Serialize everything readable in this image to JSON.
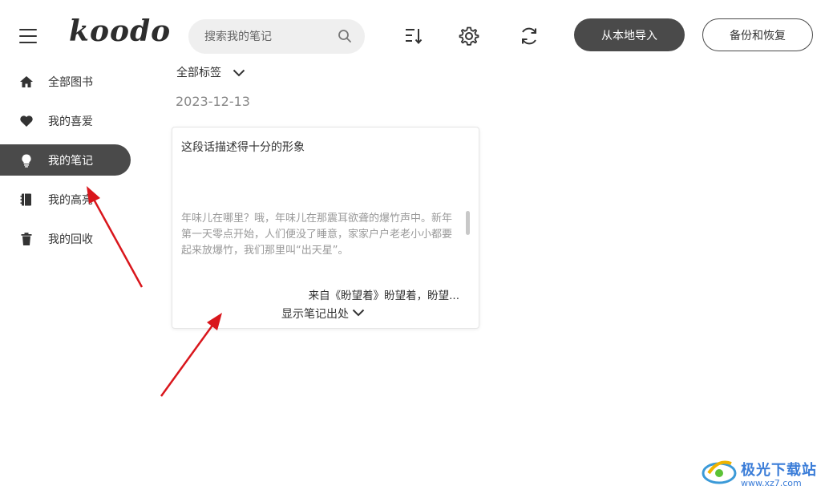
{
  "app": {
    "logo": "koodo"
  },
  "search": {
    "placeholder": "搜索我的笔记"
  },
  "header": {
    "import_label": "从本地导入",
    "backup_label": "备份和恢复"
  },
  "sidebar": {
    "items": [
      {
        "label": "全部图书",
        "icon": "home-icon"
      },
      {
        "label": "我的喜爱",
        "icon": "heart-icon"
      },
      {
        "label": "我的笔记",
        "icon": "lightbulb-icon",
        "active": true
      },
      {
        "label": "我的高亮",
        "icon": "notebook-icon"
      },
      {
        "label": "我的回收",
        "icon": "trash-icon"
      }
    ]
  },
  "main": {
    "tag_filter": "全部标签",
    "date": "2023-12-13",
    "card": {
      "note": "这段话描述得十分的形象",
      "quote": "年味儿在哪里？哦，年味儿在那震耳欲聋的爆竹声中。新年第一天零点开始，人们便没了睡意，家家户户老老小小都要起来放爆竹，我们那里叫“出天星”。",
      "source": "来自《盼望着》盼望着，盼望...",
      "show_source": "显示笔记出处"
    }
  },
  "watermark": {
    "title": "极光下载站",
    "url": "www.xz7.com"
  },
  "colors": {
    "accent_dark": "#4a4a4a",
    "annotation_red": "#d9161c",
    "watermark_blue": "#3b7dd8"
  }
}
